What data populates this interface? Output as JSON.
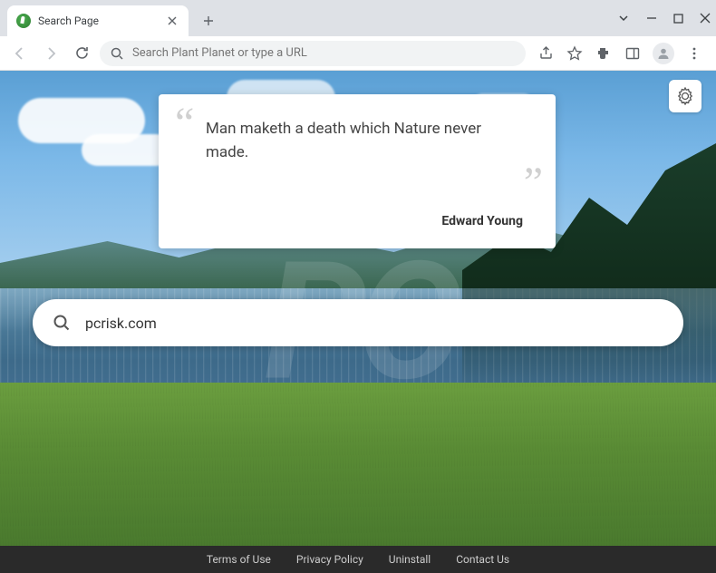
{
  "window": {
    "tab_title": "Search Page"
  },
  "toolbar": {
    "address_placeholder": "Search Plant Planet or type a URL"
  },
  "quote": {
    "text": "Man maketh a death which Nature never made.",
    "author": "Edward Young"
  },
  "search": {
    "value": "pcrisk.com"
  },
  "footer": {
    "links": [
      "Terms of Use",
      "Privacy Policy",
      "Uninstall",
      "Contact Us"
    ]
  }
}
